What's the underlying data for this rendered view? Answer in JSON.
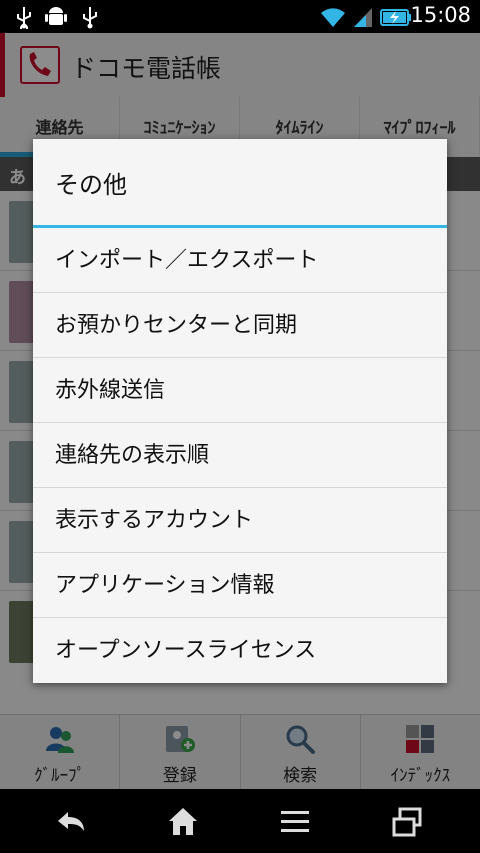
{
  "status_bar": {
    "time": "15:08",
    "icons": [
      "usb-icon",
      "android-debug-icon",
      "usb-icon",
      "wifi-icon",
      "signal-icon",
      "battery-charging-icon"
    ]
  },
  "app": {
    "title": "ドコモ電話帳",
    "brand_color": "#c8102e"
  },
  "tabs": [
    {
      "label": "連絡先",
      "active": true
    },
    {
      "label": "ｺﾐｭﾆｹｰｼｮﾝ",
      "active": false
    },
    {
      "label": "ﾀｲﾑﾗｲﾝ",
      "active": false
    },
    {
      "label": "ﾏｲﾌﾟﾛﾌｨｰﾙ",
      "active": false
    }
  ],
  "list": {
    "index_label": "あ"
  },
  "toolbar": [
    {
      "label": "ｸﾞﾙｰﾌﾟ",
      "icon": "group-icon"
    },
    {
      "label": "登録",
      "icon": "add-contact-icon"
    },
    {
      "label": "検索",
      "icon": "search-icon"
    },
    {
      "label": "ｲﾝﾃﾞｯｸｽ",
      "icon": "index-icon"
    }
  ],
  "dialog": {
    "title": "その他",
    "accent": "#33b5e5",
    "items": [
      "インポート／エクスポート",
      "お預かりセンターと同期",
      "赤外線送信",
      "連絡先の表示順",
      "表示するアカウント",
      "アプリケーション情報",
      "オープンソースライセンス"
    ]
  },
  "nav_bar": {
    "buttons": [
      "back-icon",
      "home-icon",
      "menu-icon",
      "recent-apps-icon"
    ]
  }
}
